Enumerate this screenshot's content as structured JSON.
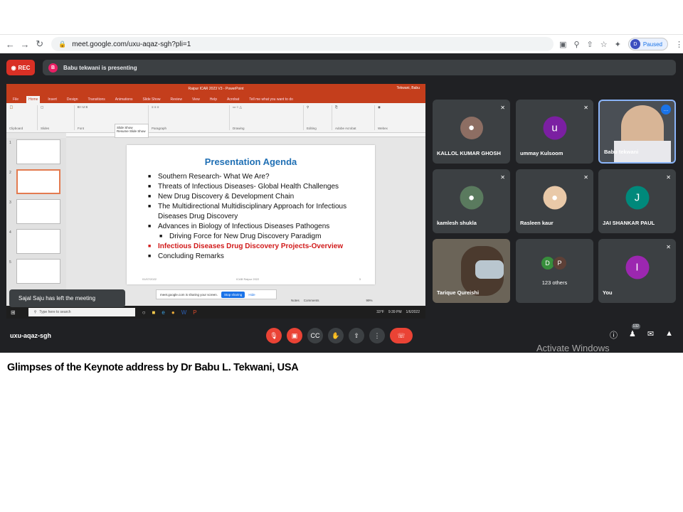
{
  "browser": {
    "url": "meet.google.com/uxu-aqaz-sgh?pli=1",
    "profile_initial": "D",
    "profile_status": "Paused"
  },
  "meet": {
    "rec_label": "REC",
    "presenter_initial": "B",
    "presenting_text": "Babu tekwani is presenting",
    "meeting_code": "uxu-aqaz-sgh",
    "toast": "Sajal Saju has left the meeting",
    "participants_count": "132",
    "watermark": "Activate Windows"
  },
  "shared_screen": {
    "window_title": "Raipur ICAR 2023 V3  -  PowerPoint",
    "user": "Tekwani, Babu",
    "tabs": [
      "File",
      "Home",
      "Insert",
      "Design",
      "Transitions",
      "Animations",
      "Slide Show",
      "Review",
      "View",
      "Help",
      "Acrobat",
      "Tell me what you want to do"
    ],
    "active_tab": "Home",
    "ribbon_groups": [
      "Clipboard",
      "Slides",
      "Font",
      "Paragraph",
      "Drawing",
      "Editing",
      "Adobe Acrobat",
      "Webex"
    ],
    "slideshow_popup": [
      "Slide Show",
      "Resume Slide Show"
    ],
    "thumb_numbers": [
      "1",
      "2",
      "3",
      "4",
      "5"
    ],
    "slide": {
      "title": "Presentation Agenda",
      "bullets": [
        "Southern Research- What We Are?",
        "Threats of Infectious Diseases- Global Health Challenges",
        "New Drug Discovery & Development Chain",
        "The Multidirectional Multidisciplinary Approach for Infectious Diseases Drug Discovery",
        "Advances in Biology of Infectious Diseases Pathogens"
      ],
      "sub_bullet": "Driving Force for New Drug Discovery Paradigm",
      "highlight_bullet": "Infectious Diseases Drug Discovery Projects-Overview",
      "last_bullet": "Concluding Remarks",
      "footer_date": "01/07/2022",
      "footer_center": "ICAB Raipur 2022",
      "footer_page": "3"
    },
    "sharing_text": "meet.google.com is sharing your screen.",
    "stop_sharing": "Stop sharing",
    "hide": "Hide",
    "notes": "Notes",
    "comments": "Comments",
    "zoom": "99%",
    "taskbar_search": "Type here to search",
    "weather": "33°F",
    "time": "9:39 PM",
    "date": "1/6/2022"
  },
  "participants": [
    {
      "name": "KALLOL KUMAR GHOSH",
      "type": "photo"
    },
    {
      "name": "ummay Kulsoom",
      "initial": "u",
      "color": "#7b1fa2"
    },
    {
      "name": "Babu tekwani",
      "type": "video"
    },
    {
      "name": "kamlesh shukla",
      "type": "photo"
    },
    {
      "name": "Rasleen kaur",
      "type": "photo"
    },
    {
      "name": "JAI SHANKAR PAUL",
      "initial": "J",
      "color": "#00897b"
    },
    {
      "name": "Tarique Qureishi",
      "type": "video"
    },
    {
      "name": "123 others",
      "initials": [
        "D",
        "P"
      ],
      "colors": [
        "#388e3c",
        "#5d4037"
      ]
    },
    {
      "name": "You",
      "initial": "I",
      "color": "#9c27b0"
    }
  ],
  "caption": "Glimpses of the Keynote address by Dr Babu L. Tekwani, USA"
}
